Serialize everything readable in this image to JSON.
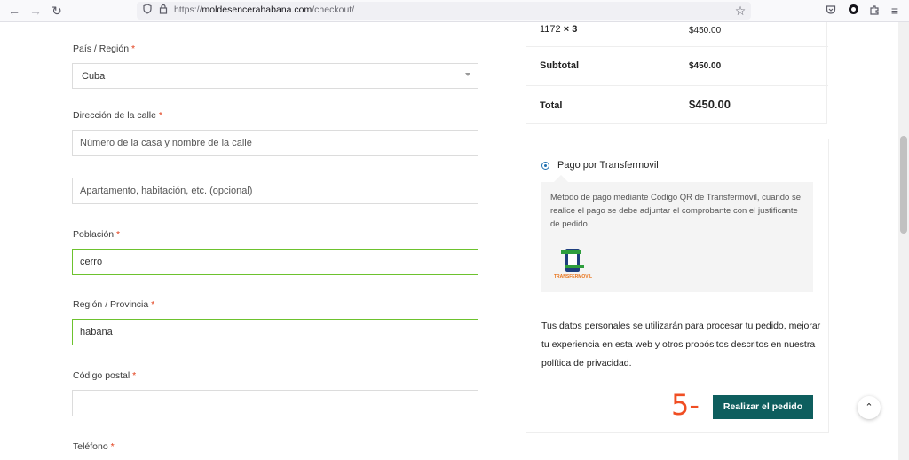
{
  "browser": {
    "url_prefix": "https://",
    "url_domain": "moldesencerahabana.com",
    "url_path": "/checkout/",
    "back_icon": "←",
    "forward_icon": "→",
    "reload_icon": "↻",
    "star_icon": "☆",
    "menu_icon": "≡"
  },
  "form": {
    "country_label": "País / Región",
    "country_value": "Cuba",
    "street_label": "Dirección de la calle",
    "street_placeholder": "Número de la casa y nombre de la calle",
    "apt_placeholder": "Apartamento, habitación, etc. (opcional)",
    "city_label": "Población",
    "city_value": "cerro",
    "region_label": "Región / Provincia",
    "region_value": "habana",
    "postal_label": "Código postal",
    "postal_value": "",
    "phone_label": "Teléfono",
    "required_mark": "*"
  },
  "order": {
    "item_name": "1172",
    "item_qty": "× 3",
    "item_price": "$450.00",
    "subtotal_label": "Subtotal",
    "subtotal_value": "$450.00",
    "total_label": "Total",
    "total_value": "$450.00"
  },
  "payment": {
    "method_label": "Pago por Transfermovil",
    "description": "Método de pago mediante Codigo QR de Transfermovil, cuando se realice el pago se debe adjuntar el comprobante con el justificante de pedido.",
    "logo_text": "TRANSFERMOVIL",
    "privacy_text": "Tus datos personales se utilizarán para procesar tu pedido, mejorar tu experiencia en esta web y otros propósitos descritos en nuestra política de privacidad.",
    "annotation": "5-",
    "place_order_label": "Realizar el pedido",
    "back_to_top_icon": "⌃"
  }
}
